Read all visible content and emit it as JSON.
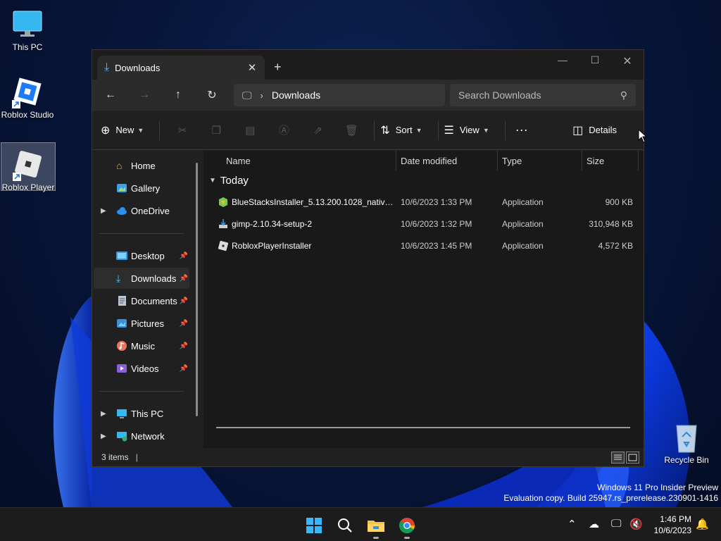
{
  "desktop": {
    "icons": [
      {
        "label": "This PC"
      },
      {
        "label": "Roblox Studio"
      },
      {
        "label": "Roblox Player"
      },
      {
        "label": "Recycle Bin"
      }
    ]
  },
  "window": {
    "tab_title": "Downloads",
    "address": {
      "location": "Downloads"
    },
    "search_placeholder": "Search Downloads",
    "commands": {
      "new": "New",
      "sort": "Sort",
      "view": "View",
      "details": "Details"
    },
    "nav": {
      "home": "Home",
      "gallery": "Gallery",
      "onedrive": "OneDrive",
      "desktop": "Desktop",
      "downloads": "Downloads",
      "documents": "Documents",
      "pictures": "Pictures",
      "music": "Music",
      "videos": "Videos",
      "thispc": "This PC",
      "network": "Network"
    },
    "columns": {
      "name": "Name",
      "date": "Date modified",
      "type": "Type",
      "size": "Size"
    },
    "group": "Today",
    "files": [
      {
        "name": "BlueStacksInstaller_5.13.200.1028_native_...",
        "date": "10/6/2023 1:33 PM",
        "type": "Application",
        "size": "900 KB"
      },
      {
        "name": "gimp-2.10.34-setup-2",
        "date": "10/6/2023 1:32 PM",
        "type": "Application",
        "size": "310,948 KB"
      },
      {
        "name": "RobloxPlayerInstaller",
        "date": "10/6/2023 1:45 PM",
        "type": "Application",
        "size": "4,572 KB"
      }
    ],
    "status": "3 items"
  },
  "watermark": {
    "line1": "Windows 11 Pro Insider Preview",
    "line2": "Evaluation copy. Build 25947.rs_prerelease.230901-1416"
  },
  "taskbar": {
    "time": "1:46 PM",
    "date": "10/6/2023"
  },
  "colors": {
    "accent": "#4cc2ff",
    "window_bg": "#202020",
    "taskbar_bg": "#1c1c1c"
  }
}
